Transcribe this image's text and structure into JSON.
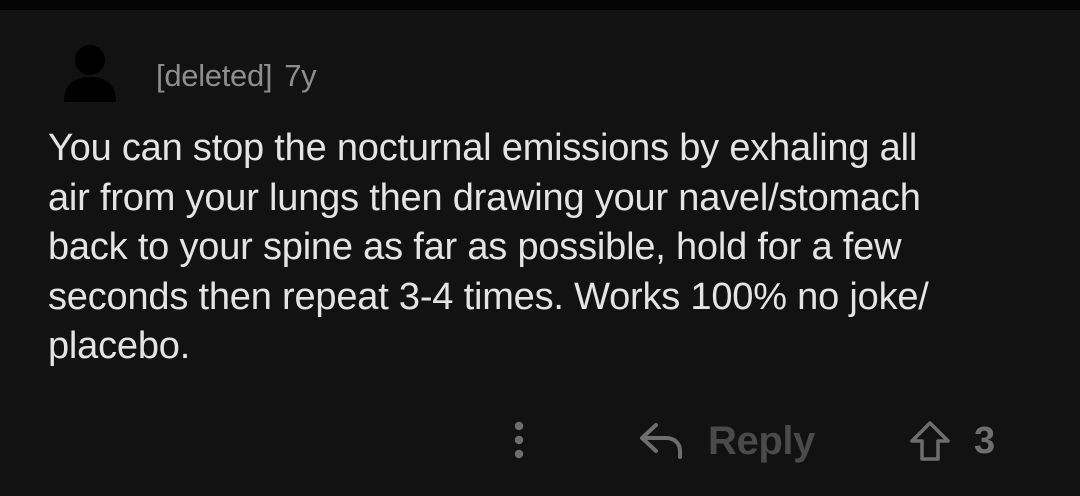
{
  "comment": {
    "author": "[deleted]",
    "age": "7y",
    "body": "You can stop the nocturnal emissions by exhaling all\nair from your lungs then drawing your navel/stomach\nback to your spine as far as possible, hold for a few\nseconds then repeat 3-4 times. Works 100% no joke/\nplacebo.",
    "avatar_icon": "person-silhouette-icon"
  },
  "actions": {
    "more_icon": "vertical-ellipsis-icon",
    "reply_icon": "reply-arrow-icon",
    "reply_label": "Reply",
    "upvote_icon": "upvote-arrow-icon",
    "vote_count": "3"
  },
  "colors": {
    "background": "#121212",
    "body_text": "#e4e4e4",
    "meta_text": "#8e8e8e",
    "muted_action": "#4a4a4a",
    "icon": "#6e6e6e"
  }
}
